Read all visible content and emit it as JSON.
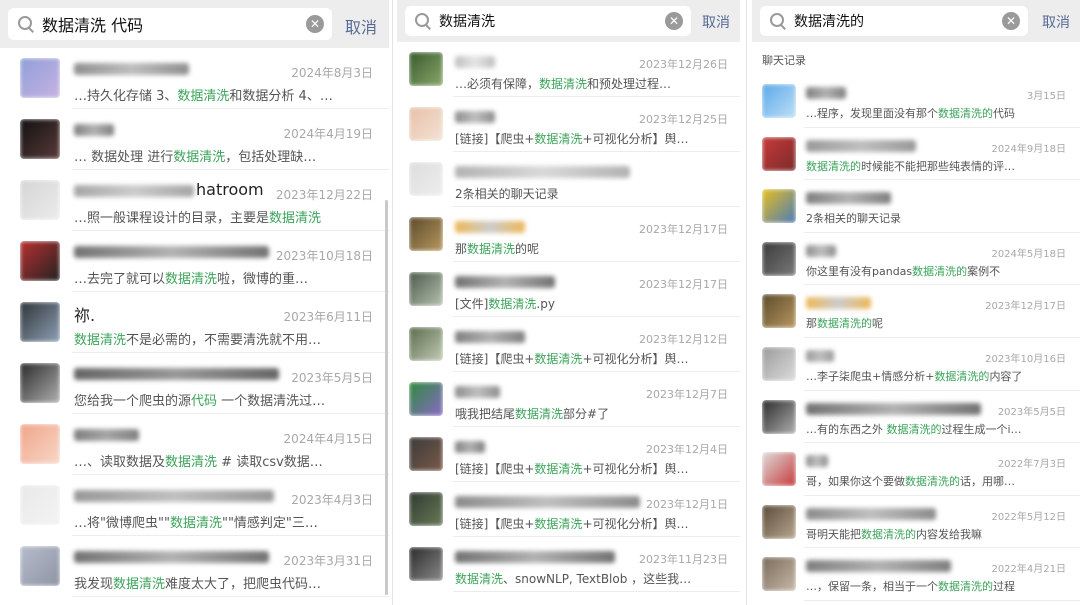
{
  "colors": {
    "highlight": "#3ca35a",
    "link": "#576b95",
    "muted": "#a8a8a8"
  },
  "panels": [
    {
      "query": "数据清洗 代码",
      "cancel": "取消",
      "section_title": "",
      "items": [
        {
          "name": "",
          "date": "2024年8月3日",
          "pre": "…持久化存储 3、",
          "hl": "数据清洗",
          "post": "和数据分析 4、…",
          "av": [
            "#8f9fd8",
            "#c8b2e2"
          ],
          "nb": [
            "#6a6a6a",
            "#a8a8a8"
          ],
          "nw": 115
        },
        {
          "name": "",
          "date": "2024年4月19日",
          "pre": "… 数据处理 进行",
          "hl": "数据清洗",
          "post": "，包括处理缺…",
          "av": [
            "#111111",
            "#5a3a3a"
          ],
          "nb": [
            "#555555",
            "#999999"
          ],
          "nw": 40
        },
        {
          "name": "hatroom",
          "date": "2023年12月22日",
          "pre": "…照一般课程设计的目录，主要是",
          "hl": "数据清洗",
          "post": "",
          "av": [
            "#d5d5d5",
            "#ececec"
          ],
          "nb": [
            "#888888",
            "#bbbbbb"
          ],
          "nw": 120
        },
        {
          "name": "",
          "date": "2023年10月18日",
          "pre": "…去完了就可以",
          "hl": "数据清洗",
          "post": "啦，微博的重…",
          "av": [
            "#b83030",
            "#222222"
          ],
          "nb": [
            "#444444",
            "#999999"
          ],
          "nw": 195
        },
        {
          "name": "祢.",
          "date": "2023年6月11日",
          "pre": "",
          "hl": "数据清洗",
          "post": "不是必需的，不需要清洗就不用…",
          "av": [
            "#2f3438",
            "#8da0b5"
          ],
          "nb": [
            "#ffffff",
            "#ffffff"
          ],
          "nw": 0
        },
        {
          "name": "",
          "date": "2023年5月5日",
          "pre": "您给我一个爬虫的源",
          "hl": "代码",
          "post": " 一个数据清洗过…",
          "av": [
            "#2a2a2a",
            "#b0b0b0"
          ],
          "nb": [
            "#333333",
            "#777777"
          ],
          "nw": 205
        },
        {
          "name": "",
          "date": "2024年4月15日",
          "pre": "…、读取数据及",
          "hl": "数据清洗",
          "post": " # 读取csv数据…",
          "av": [
            "#f1a58a",
            "#f6d7c7"
          ],
          "nb": [
            "#555555",
            "#888888"
          ],
          "nw": 65
        },
        {
          "name": "",
          "date": "2023年4月3日",
          "pre": "…将\"微博爬虫\"\"",
          "hl": "数据清洗",
          "post": "\"\"情感判定\"三…",
          "av": [
            "#e9e9e9",
            "#f3f3f3"
          ],
          "nb": [
            "#777777",
            "#aaaaaa"
          ],
          "nw": 200
        },
        {
          "name": "",
          "date": "2023年3月31日",
          "pre": "我发现",
          "hl": "数据清洗",
          "post": "难度太大了，把爬虫代码…",
          "av": [
            "#b5bccb",
            "#8f94a3"
          ],
          "nb": [
            "#444444",
            "#999999"
          ],
          "nw": 195
        }
      ]
    },
    {
      "query": "数据清洗",
      "cancel": "取消",
      "section_title": "",
      "items": [
        {
          "name": "",
          "date": "2023年12月26日",
          "pre": "…必须有保障，",
          "hl": "数据清洗",
          "post": "和预处理过程…",
          "av": [
            "#365a2c",
            "#8aa86a"
          ],
          "nb": [
            "#aaaaaa",
            "#dddddd"
          ],
          "nw": 40
        },
        {
          "name": "",
          "date": "2023年12月25日",
          "pre": "[链接]【爬虫+",
          "hl": "数据清洗",
          "post": "+可视化分析】舆…",
          "av": [
            "#e8c0a8",
            "#f3e2d5"
          ],
          "nb": [
            "#666666",
            "#aaaaaa"
          ],
          "nw": 40
        },
        {
          "name": "",
          "date": "",
          "pre": "2条相关的聊天记录",
          "hl": "",
          "post": "",
          "av": [
            "#dddddd",
            "#eeeeee"
          ],
          "nb": [
            "#999999",
            "#cccccc"
          ],
          "nw": 175
        },
        {
          "name": "",
          "date": "2023年12月17日",
          "pre": "那",
          "hl": "数据清洗",
          "post": "的呢",
          "av": [
            "#5a4a2a",
            "#b89860"
          ],
          "nb": [
            "#e8a020",
            "#bbbbbb"
          ],
          "nw": 70
        },
        {
          "name": "",
          "date": "2023年12月17日",
          "pre": "[文件]",
          "hl": "数据清洗",
          "post": ".py",
          "av": [
            "#4a5a4a",
            "#b8c2b0"
          ],
          "nb": [
            "#444444",
            "#999999"
          ],
          "nw": 100
        },
        {
          "name": "",
          "date": "2023年12月12日",
          "pre": "[链接]【爬虫+",
          "hl": "数据清洗",
          "post": "+可视化分析】舆…",
          "av": [
            "#5a6a4a",
            "#c2cbb5"
          ],
          "nb": [
            "#555555",
            "#999999"
          ],
          "nw": 70
        },
        {
          "name": "",
          "date": "2023年12月7日",
          "pre": "哦我把结尾",
          "hl": "数据清洗",
          "post": "部分#了",
          "av": [
            "#2e8a3a",
            "#8a6ac8"
          ],
          "nb": [
            "#666666",
            "#aaaaaa"
          ],
          "nw": 45
        },
        {
          "name": "",
          "date": "2023年12月4日",
          "pre": "[链接]【爬虫+",
          "hl": "数据清洗",
          "post": "+可视化分析】舆…",
          "av": [
            "#3a3a3a",
            "#7a5a4a"
          ],
          "nb": [
            "#555555",
            "#999999"
          ],
          "nw": 30
        },
        {
          "name": "",
          "date": "2023年12月1日",
          "pre": "[链接]【爬虫+",
          "hl": "数据清洗",
          "post": "+可视化分析】舆…",
          "av": [
            "#2f3a2f",
            "#6a7a5a"
          ],
          "nb": [
            "#666666",
            "#aaaaaa"
          ],
          "nw": 185
        },
        {
          "name": "",
          "date": "2023年11月23日",
          "pre": "",
          "hl": "数据清洗",
          "post": "、snowNLP, TextBlob ，这些我…",
          "av": [
            "#2a2a2a",
            "#8a8a8a"
          ],
          "nb": [
            "#444444",
            "#999999"
          ],
          "nw": 160
        }
      ]
    },
    {
      "query": "数据清洗的",
      "cancel": "取消",
      "section_title": "聊天记录",
      "items": [
        {
          "name": "",
          "date": "3月15日",
          "pre": "…程序，发现里面没有那个",
          "hl": "数据清洗的",
          "post": "代码",
          "av": [
            "#5aa8e8",
            "#bfe0f8"
          ],
          "nb": [
            "#555555",
            "#999999"
          ],
          "nw": 40
        },
        {
          "name": "",
          "date": "2024年9月18日",
          "pre": "",
          "hl": "数据清洗的",
          "post": "时候能不能把那些纯表情的评…",
          "av": [
            "#c83a3a",
            "#7a2a2a"
          ],
          "nb": [
            "#777777",
            "#aaaaaa"
          ],
          "nw": 110
        },
        {
          "name": "",
          "date": "",
          "pre": "2条相关的聊天记录",
          "hl": "",
          "post": "",
          "av": [
            "#e8c020",
            "#4a7ab8"
          ],
          "nb": [
            "#555555",
            "#999999"
          ],
          "nw": 85
        },
        {
          "name": "",
          "date": "2024年5月18日",
          "pre": "你这里有没有pandas",
          "hl": "数据清洗的",
          "post": "案例不",
          "av": [
            "#3a3a3a",
            "#7a7a7a"
          ],
          "nb": [
            "#666666",
            "#aaaaaa"
          ],
          "nw": 30
        },
        {
          "name": "",
          "date": "2023年12月17日",
          "pre": "那",
          "hl": "数据清洗的",
          "post": "呢",
          "av": [
            "#5a4a2a",
            "#b89860"
          ],
          "nb": [
            "#e8a020",
            "#bbbbbb"
          ],
          "nw": 65
        },
        {
          "name": "",
          "date": "2023年10月16日",
          "pre": "…李子柒爬虫+情感分析+",
          "hl": "数据清洗的",
          "post": "内容了",
          "av": [
            "#9a9a9a",
            "#dddddd"
          ],
          "nb": [
            "#777777",
            "#aaaaaa"
          ],
          "nw": 28
        },
        {
          "name": "",
          "date": "2023年5月5日",
          "pre": "…有的东西之外 ",
          "hl": "数据清洗的",
          "post": "过程生成一个i…",
          "av": [
            "#2a2a2a",
            "#b0b0b0"
          ],
          "nb": [
            "#444444",
            "#999999"
          ],
          "nw": 175
        },
        {
          "name": "",
          "date": "2022年7月3日",
          "pre": "哥，如果你这个要做",
          "hl": "数据清洗的",
          "post": "话，用哪…",
          "av": [
            "#dddddd",
            "#c83a3a"
          ],
          "nb": [
            "#666666",
            "#aaaaaa"
          ],
          "nw": 22
        },
        {
          "name": "",
          "date": "2022年5月12日",
          "pre": "哥明天能把",
          "hl": "数据清洗的",
          "post": "内容发给我嘛",
          "av": [
            "#5a4a3a",
            "#b8a890"
          ],
          "nb": [
            "#666666",
            "#aaaaaa"
          ],
          "nw": 130
        },
        {
          "name": "",
          "date": "2022年4月21日",
          "pre": "…，保留一条，相当于一个",
          "hl": "数据清洗的",
          "post": "过程",
          "av": [
            "#7a6a5a",
            "#c8b8a8"
          ],
          "nb": [
            "#555555",
            "#999999"
          ],
          "nw": 145
        }
      ]
    }
  ]
}
